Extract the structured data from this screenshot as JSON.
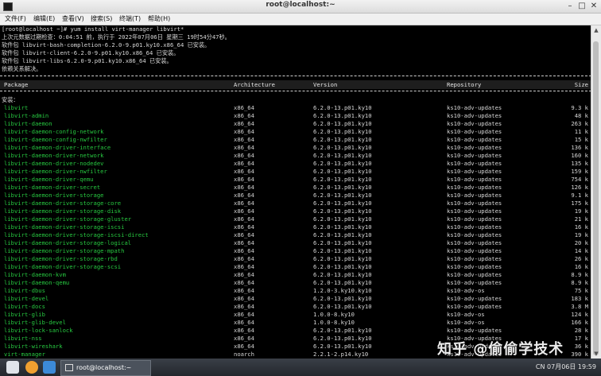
{
  "window": {
    "title": "root@localhost:~"
  },
  "menubar": [
    "文件(F)",
    "编辑(E)",
    "查看(V)",
    "搜索(S)",
    "终端(T)",
    "帮助(H)"
  ],
  "terminal": {
    "lines_top": [
      "[root@localhost ~]# yum install virt-manager libvirt*",
      "上次元数据过期检查：0:04:51 前，执行于 2022年07月06日 星期三 19时54分47秒。",
      "软件包 libvirt-bash-completion-6.2.0-9.p01.ky10.x86_64 已安装。",
      "软件包 libvirt-client-6.2.0-9.p01.ky10.x86_64 已安装。",
      "软件包 libvirt-libs-6.2.0-9.p01.ky10.x86_64 已安装。",
      "依赖关系解决。"
    ],
    "header": {
      "package": "Package",
      "arch": "Architecture",
      "version": "Version",
      "repo": "Repository",
      "size": "Size"
    },
    "install_label": "安装：",
    "packages": [
      {
        "name": "libvirt",
        "arch": "x86_64",
        "version": "6.2.0-13.p01.ky10",
        "repo": "ks10-adv-updates",
        "size": "9.3 k"
      },
      {
        "name": "libvirt-admin",
        "arch": "x86_64",
        "version": "6.2.0-13.p01.ky10",
        "repo": "ks10-adv-updates",
        "size": "48 k"
      },
      {
        "name": "libvirt-daemon",
        "arch": "x86_64",
        "version": "6.2.0-13.p01.ky10",
        "repo": "ks10-adv-updates",
        "size": "263 k"
      },
      {
        "name": "libvirt-daemon-config-network",
        "arch": "x86_64",
        "version": "6.2.0-13.p01.ky10",
        "repo": "ks10-adv-updates",
        "size": "11 k"
      },
      {
        "name": "libvirt-daemon-config-nwfilter",
        "arch": "x86_64",
        "version": "6.2.0-13.p01.ky10",
        "repo": "ks10-adv-updates",
        "size": "15 k"
      },
      {
        "name": "libvirt-daemon-driver-interface",
        "arch": "x86_64",
        "version": "6.2.0-13.p01.ky10",
        "repo": "ks10-adv-updates",
        "size": "136 k"
      },
      {
        "name": "libvirt-daemon-driver-network",
        "arch": "x86_64",
        "version": "6.2.0-13.p01.ky10",
        "repo": "ks10-adv-updates",
        "size": "160 k"
      },
      {
        "name": "libvirt-daemon-driver-nodedev",
        "arch": "x86_64",
        "version": "6.2.0-13.p01.ky10",
        "repo": "ks10-adv-updates",
        "size": "135 k"
      },
      {
        "name": "libvirt-daemon-driver-nwfilter",
        "arch": "x86_64",
        "version": "6.2.0-13.p01.ky10",
        "repo": "ks10-adv-updates",
        "size": "159 k"
      },
      {
        "name": "libvirt-daemon-driver-qemu",
        "arch": "x86_64",
        "version": "6.2.0-13.p01.ky10",
        "repo": "ks10-adv-updates",
        "size": "754 k"
      },
      {
        "name": "libvirt-daemon-driver-secret",
        "arch": "x86_64",
        "version": "6.2.0-13.p01.ky10",
        "repo": "ks10-adv-updates",
        "size": "126 k"
      },
      {
        "name": "libvirt-daemon-driver-storage",
        "arch": "x86_64",
        "version": "6.2.0-13.p01.ky10",
        "repo": "ks10-adv-updates",
        "size": "9.1 k"
      },
      {
        "name": "libvirt-daemon-driver-storage-core",
        "arch": "x86_64",
        "version": "6.2.0-13.p01.ky10",
        "repo": "ks10-adv-updates",
        "size": "175 k"
      },
      {
        "name": "libvirt-daemon-driver-storage-disk",
        "arch": "x86_64",
        "version": "6.2.0-13.p01.ky10",
        "repo": "ks10-adv-updates",
        "size": "19 k"
      },
      {
        "name": "libvirt-daemon-driver-storage-gluster",
        "arch": "x86_64",
        "version": "6.2.0-13.p01.ky10",
        "repo": "ks10-adv-updates",
        "size": "21 k"
      },
      {
        "name": "libvirt-daemon-driver-storage-iscsi",
        "arch": "x86_64",
        "version": "6.2.0-13.p01.ky10",
        "repo": "ks10-adv-updates",
        "size": "16 k"
      },
      {
        "name": "libvirt-daemon-driver-storage-iscsi-direct",
        "arch": "x86_64",
        "version": "6.2.0-13.p01.ky10",
        "repo": "ks10-adv-updates",
        "size": "19 k"
      },
      {
        "name": "libvirt-daemon-driver-storage-logical",
        "arch": "x86_64",
        "version": "6.2.0-13.p01.ky10",
        "repo": "ks10-adv-updates",
        "size": "20 k"
      },
      {
        "name": "libvirt-daemon-driver-storage-mpath",
        "arch": "x86_64",
        "version": "6.2.0-13.p01.ky10",
        "repo": "ks10-adv-updates",
        "size": "14 k"
      },
      {
        "name": "libvirt-daemon-driver-storage-rbd",
        "arch": "x86_64",
        "version": "6.2.0-13.p01.ky10",
        "repo": "ks10-adv-updates",
        "size": "26 k"
      },
      {
        "name": "libvirt-daemon-driver-storage-scsi",
        "arch": "x86_64",
        "version": "6.2.0-13.p01.ky10",
        "repo": "ks10-adv-updates",
        "size": "16 k"
      },
      {
        "name": "libvirt-daemon-kvm",
        "arch": "x86_64",
        "version": "6.2.0-13.p01.ky10",
        "repo": "ks10-adv-updates",
        "size": "8.9 k"
      },
      {
        "name": "libvirt-daemon-qemu",
        "arch": "x86_64",
        "version": "6.2.0-13.p01.ky10",
        "repo": "ks10-adv-updates",
        "size": "8.9 k"
      },
      {
        "name": "libvirt-dbus",
        "arch": "x86_64",
        "version": "1.2.0-3.ky10.ky10",
        "repo": "ks10-adv-os",
        "size": "75 k"
      },
      {
        "name": "libvirt-devel",
        "arch": "x86_64",
        "version": "6.2.0-13.p01.ky10",
        "repo": "ks10-adv-updates",
        "size": "183 k"
      },
      {
        "name": "libvirt-docs",
        "arch": "x86_64",
        "version": "6.2.0-13.p01.ky10",
        "repo": "ks10-adv-updates",
        "size": "3.8 M"
      },
      {
        "name": "libvirt-glib",
        "arch": "x86_64",
        "version": "1.0.0-8.ky10",
        "repo": "ks10-adv-os",
        "size": "124 k"
      },
      {
        "name": "libvirt-glib-devel",
        "arch": "x86_64",
        "version": "1.0.0-8.ky10",
        "repo": "ks10-adv-os",
        "size": "166 k"
      },
      {
        "name": "libvirt-lock-sanlock",
        "arch": "x86_64",
        "version": "6.2.0-13.p01.ky10",
        "repo": "ks10-adv-updates",
        "size": "28 k"
      },
      {
        "name": "libvirt-nss",
        "arch": "x86_64",
        "version": "6.2.0-13.p01.ky10",
        "repo": "ks10-adv-updates",
        "size": "17 k"
      },
      {
        "name": "libvirt-wireshark",
        "arch": "x86_64",
        "version": "6.2.0-13.p01.ky10",
        "repo": "ks10-adv-updates",
        "size": "36 k"
      },
      {
        "name": "virt-manager",
        "arch": "noarch",
        "version": "2.2.1-2.p14.ky10",
        "repo": "ks10-adv-updates",
        "size": "390 k"
      }
    ]
  },
  "taskbar": {
    "task_label": "root@localhost:~",
    "tray_text": "CN 07月06日 19:59"
  },
  "watermark": {
    "text": "知乎 @偷偷学技术"
  },
  "colors": {
    "package_green": "#27c840",
    "terminal_bg": "#000000",
    "taskbar_bg": "#2c3038"
  }
}
